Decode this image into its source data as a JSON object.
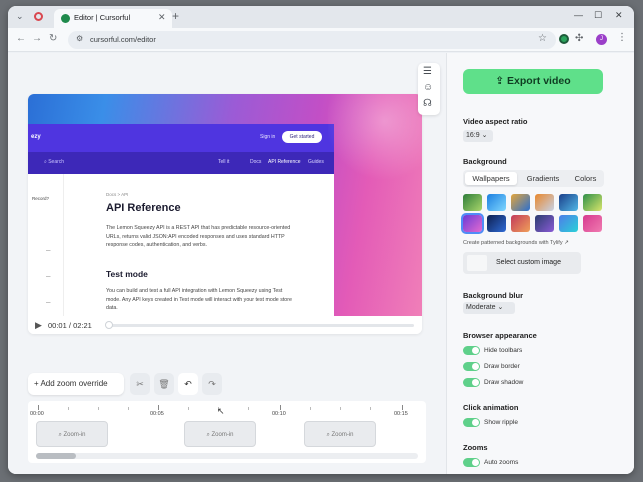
{
  "browser": {
    "tab_title": "Editor | Cursorful",
    "url": "cursorful.com/editor"
  },
  "preview_site": {
    "logo": "ezy",
    "signin": "Sign in",
    "cta": "Get started",
    "search_placeholder": "Search",
    "nav_links": [
      "Tell it",
      "Docs",
      "API Reference",
      "Guides"
    ],
    "sidebar_items": [
      "Record?",
      "—",
      "—",
      "—"
    ],
    "breadcrumb": "Docs > API",
    "title": "API Reference",
    "intro_text": "The Lemon Squeezy API is a REST API that has predictable resource-oriented URLs, returns valid JSON:API encoded responses and uses standard HTTP response codes, authentication, and verbs.",
    "section_title": "Test mode",
    "section_text": "You can build and test a full API integration with Lemon Squeezy using Test mode. Any API keys created in Test mode will interact with your test mode store data."
  },
  "player": {
    "current_time": "00:01",
    "separator": "/",
    "duration": "02:21",
    "progress": 0.01
  },
  "zoom_toolbar": {
    "add_label": "Add zoom override"
  },
  "timeline": {
    "ticks": [
      "00:00",
      "00:05",
      "00:10",
      "00:15"
    ],
    "blocks": [
      "Zoom-in",
      "Zoom-in",
      "Zoom-in"
    ]
  },
  "panel": {
    "export_label": "Export video",
    "aspect_title": "Video aspect ratio",
    "aspect_value": "16:9",
    "background_title": "Background",
    "background_tabs": [
      "Wallpapers",
      "Gradients",
      "Colors"
    ],
    "wallpaper_caption": "Create patterned backgrounds with Tylify ↗",
    "custom_image_label": "Select custom image",
    "blur_title": "Background blur",
    "blur_value": "Moderate",
    "appearance_title": "Browser appearance",
    "appearance_toggles": [
      "Hide toolbars",
      "Draw border",
      "Draw shadow"
    ],
    "click_title": "Click animation",
    "click_toggles": [
      "Show ripple"
    ],
    "zooms_title": "Zooms",
    "zoom_toggles": [
      "Auto zooms"
    ]
  },
  "colors": {
    "export_green": "#5fe08a",
    "toggle_green": "#5fd08a",
    "site_purple": "#4f35e0"
  },
  "icons": [
    "chevron-down-icon",
    "close-icon",
    "plus-icon",
    "back-icon",
    "forward-icon",
    "reload-icon",
    "tune-icon",
    "star-icon",
    "puzzle-icon",
    "menu-icon",
    "sliders-icon",
    "user-icon",
    "headset-icon",
    "play-icon",
    "scissors-icon",
    "trash-icon",
    "undo-icon",
    "redo-icon",
    "export-icon",
    "zoom-icon"
  ]
}
